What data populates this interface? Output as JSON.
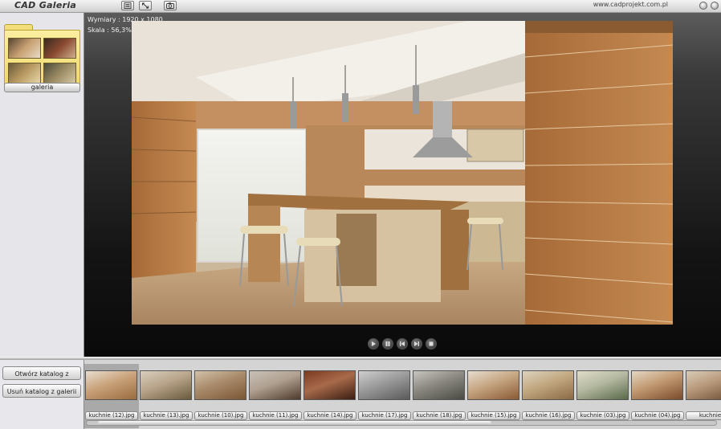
{
  "app": {
    "title": "CAD Galeria",
    "url": "www.cadprojekt.com.pl"
  },
  "toolbar": {
    "icons": [
      "list-icon",
      "resize-icon",
      "camera-icon"
    ]
  },
  "sidebar": {
    "folder_label": "galeria"
  },
  "viewer": {
    "dimensions_text": "Wymiary : 1920 x 1080",
    "scale_text": "Skala : 56,3%",
    "controls": [
      "play-icon",
      "pause-icon",
      "previous-icon",
      "next-icon",
      "stop-icon"
    ]
  },
  "actions": {
    "open_catalog": "Otwórz katalog z obrazami",
    "remove_catalog": "Usuń katalog z galerii"
  },
  "thumbnails": [
    {
      "label": "kuchnie (12).jpg",
      "selected": true,
      "c1": "#e8ddd0",
      "c2": "#9a6b3e",
      "c3": "#c9a27a"
    },
    {
      "label": "kuchnie (13).jpg",
      "selected": false,
      "c1": "#d8cfbe",
      "c2": "#6a5a3c",
      "c3": "#b8a48a"
    },
    {
      "label": "kuchnie (10).jpg",
      "selected": false,
      "c1": "#d2c2aa",
      "c2": "#7a5634",
      "c3": "#a88a6a"
    },
    {
      "label": "kuchnie (11).jpg",
      "selected": false,
      "c1": "#c9c2b8",
      "c2": "#4e3a2a",
      "c3": "#b0a090"
    },
    {
      "label": "kuchnie (14).jpg",
      "selected": false,
      "c1": "#7a3a22",
      "c2": "#3a1e12",
      "c3": "#a86a4a"
    },
    {
      "label": "kuchnie (17).jpg",
      "selected": false,
      "c1": "#cfcfcf",
      "c2": "#5a5a5a",
      "c3": "#9a9a9a"
    },
    {
      "label": "kuchnie (18).jpg",
      "selected": false,
      "c1": "#c8c6c0",
      "c2": "#4a4a44",
      "c3": "#8a8880"
    },
    {
      "label": "kuchnie (15).jpg",
      "selected": false,
      "c1": "#e6ddd0",
      "c2": "#8a5a34",
      "c3": "#c6a682"
    },
    {
      "label": "kuchnie (16).jpg",
      "selected": false,
      "c1": "#ddd2c0",
      "c2": "#8a6a44",
      "c3": "#c2a880"
    },
    {
      "label": "kuchnie (03).jpg",
      "selected": false,
      "c1": "#e0dcc8",
      "c2": "#5a6a4a",
      "c3": "#b4b8a0"
    },
    {
      "label": "kuchnie (04).jpg",
      "selected": false,
      "c1": "#e4d8c6",
      "c2": "#7a4a2a",
      "c3": "#c29a72"
    },
    {
      "label": "kuchnie (",
      "selected": false,
      "c1": "#d8ccb8",
      "c2": "#6a4a30",
      "c3": "#b8987a"
    }
  ]
}
